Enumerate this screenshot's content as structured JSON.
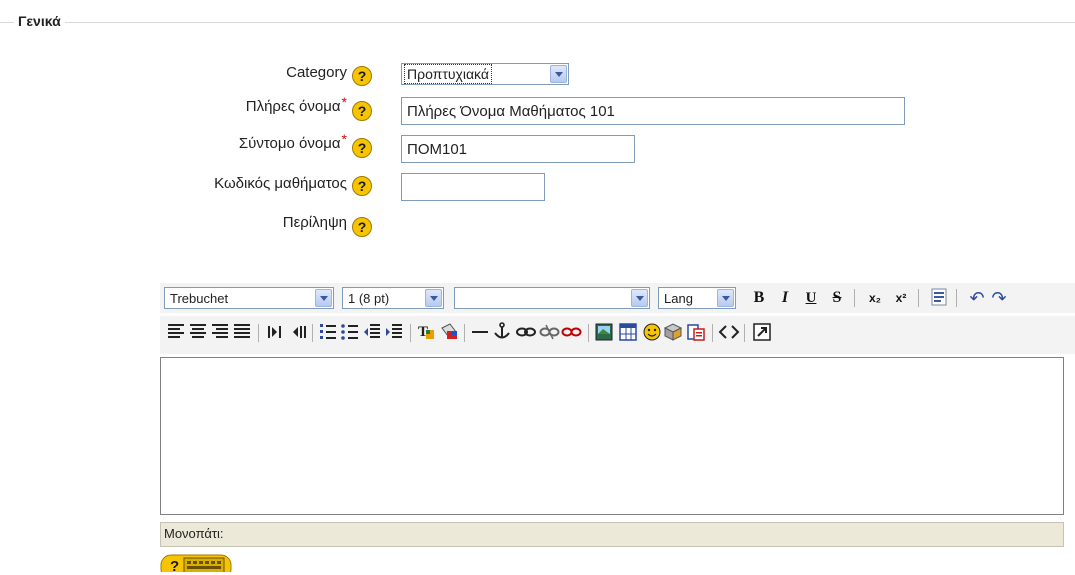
{
  "fieldset": {
    "legend": "Γενικά"
  },
  "fields": {
    "category": {
      "label": "Category",
      "value": "Προπτυχιακά"
    },
    "fullname": {
      "label": "Πλήρες όνομα",
      "required_mark": "*",
      "value": "Πλήρες Όνομα Μαθήματος 101"
    },
    "shortname": {
      "label": "Σύντομο όνομα",
      "required_mark": "*",
      "value": "ΠΟΜ101"
    },
    "idnumber": {
      "label": "Κωδικός μαθήματος",
      "value": ""
    },
    "summary": {
      "label": "Περίληψη"
    }
  },
  "help_glyph": "?",
  "editor": {
    "font_family": "Trebuchet",
    "font_size": "1 (8 pt)",
    "format": "",
    "lang": "Lang",
    "buttons_row1": {
      "bold": "B",
      "italic": "I",
      "underline": "U",
      "strike": "S",
      "sub": "x₂",
      "sup": "x²",
      "undo": "↶",
      "redo": "↷"
    },
    "path_label": "Μονοπάτι:"
  },
  "colors": {
    "help_icon": "#f6c400",
    "required": "#dd0000",
    "status_bar": "#ece9d8"
  }
}
